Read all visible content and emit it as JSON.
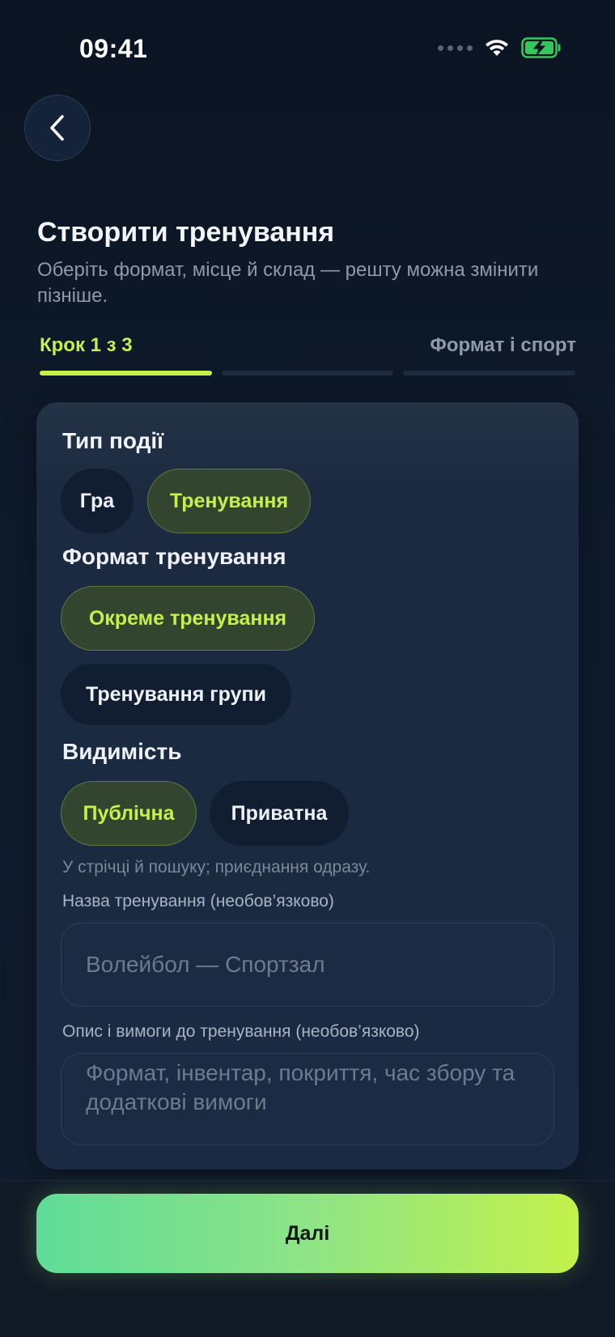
{
  "status_bar": {
    "time": "09:41"
  },
  "header": {
    "title": "Створити тренування",
    "subtitle": "Оберіть формат, місце й склад — решту можна змінити пізніше."
  },
  "stepper": {
    "step_label": "Крок 1 з 3",
    "step_name": "Формат і спорт",
    "current_step": 1,
    "total_steps": 3
  },
  "event_type": {
    "label": "Тип події",
    "options": [
      "Гра",
      "Тренування"
    ],
    "selected": "Тренування"
  },
  "training_format": {
    "label": "Формат тренування",
    "options": [
      "Окреме тренування",
      "Тренування групи"
    ],
    "selected": "Окреме тренування"
  },
  "visibility": {
    "label": "Видимість",
    "options": [
      "Публічна",
      "Приватна"
    ],
    "selected": "Публічна",
    "hint": "У стрічці й пошуку; приєднання одразу."
  },
  "name_field": {
    "label": "Назва тренування (необов’язково)",
    "placeholder": "Волейбол — Спортзал",
    "value": ""
  },
  "description_field": {
    "label": "Опис і вимоги до тренування (необов’язково)",
    "placeholder": "Формат, інвентар, покриття, час збору та додаткові вимоги",
    "value": ""
  },
  "next_button": {
    "label": "Далі"
  },
  "colors": {
    "accent": "#c5f04a",
    "background": "#0f1a2a",
    "card": "#1a2a42",
    "button_gradient_start": "#5fdc98",
    "button_gradient_end": "#c3f24b"
  }
}
